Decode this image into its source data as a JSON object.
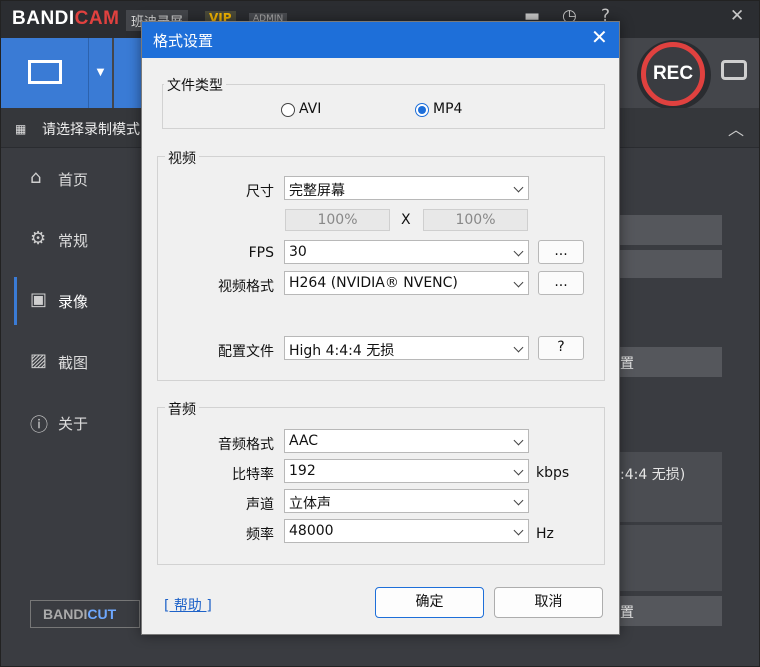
{
  "app": {
    "logo_main": "BANDI",
    "logo_red": "CAM",
    "logo_sub": "班迪录屏",
    "vip": "VIP",
    "admin": "ADMIN",
    "rec_label": "REC",
    "subbar_text": "请选择录制模式",
    "sidebar": [
      {
        "label": "首页",
        "icon": "home-icon"
      },
      {
        "label": "常规",
        "icon": "gear-icon"
      },
      {
        "label": "录像",
        "icon": "video-icon"
      },
      {
        "label": "截图",
        "icon": "image-icon"
      },
      {
        "label": "关于",
        "icon": "info-icon"
      }
    ],
    "bandicut_a": "BANDI",
    "bandicut_b": "CUT",
    "right_partial": {
      "btn1": "置",
      "profile_text": ":4:4 无损)",
      "btn2": "置"
    }
  },
  "dialog": {
    "title": "格式设置",
    "file_type": {
      "label": "文件类型",
      "options": [
        "AVI",
        "MP4"
      ],
      "selected": "MP4"
    },
    "video": {
      "label": "视频",
      "size_label": "尺寸",
      "size_value": "完整屏幕",
      "width_pct": "100%",
      "x": "X",
      "height_pct": "100%",
      "fps_label": "FPS",
      "fps_value": "30",
      "codec_label": "视频格式",
      "codec_value": "H264 (NVIDIA® NVENC)",
      "more": "...",
      "profile_label": "配置文件",
      "profile_value": "High 4:4:4 无损",
      "help_btn": "?"
    },
    "audio": {
      "label": "音频",
      "codec_label": "音频格式",
      "codec_value": "AAC",
      "bitrate_label": "比特率",
      "bitrate_value": "192",
      "bitrate_unit": "kbps",
      "channel_label": "声道",
      "channel_value": "立体声",
      "freq_label": "频率",
      "freq_value": "48000",
      "freq_unit": "Hz"
    },
    "help_link": "[ 帮助 ]",
    "ok": "确定",
    "cancel": "取消"
  }
}
